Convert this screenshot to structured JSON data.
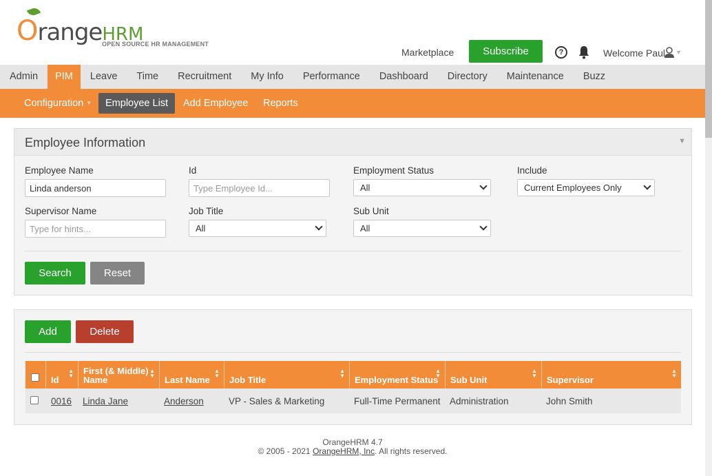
{
  "header": {
    "logo_o": "O",
    "logo_rest": "range",
    "logo_hrm": "HRM",
    "logo_tagline": "OPEN SOURCE HR MANAGEMENT",
    "marketplace_label": "Marketplace",
    "subscribe_label": "Subscribe",
    "help_glyph": "?",
    "welcome_text": "Welcome Paul",
    "user_caret": "▾"
  },
  "main_nav": {
    "items": [
      "Admin",
      "PIM",
      "Leave",
      "Time",
      "Recruitment",
      "My Info",
      "Performance",
      "Dashboard",
      "Directory",
      "Maintenance",
      "Buzz"
    ],
    "active": "PIM"
  },
  "sub_nav": {
    "configuration": "Configuration",
    "caret": "▼",
    "employee_list": "Employee List",
    "add_employee": "Add Employee",
    "reports": "Reports"
  },
  "search_panel": {
    "title": "Employee Information",
    "toggle_glyph": "▼",
    "employee_name_label": "Employee Name",
    "employee_name_value": "Linda anderson",
    "id_label": "Id",
    "id_placeholder": "Type Employee Id...",
    "employment_status_label": "Employment Status",
    "employment_status_value": "All",
    "include_label": "Include",
    "include_value": "Current Employees Only",
    "supervisor_label": "Supervisor Name",
    "supervisor_placeholder": "Type for hints...",
    "job_title_label": "Job Title",
    "job_title_value": "All",
    "sub_unit_label": "Sub Unit",
    "sub_unit_value": "All",
    "search_label": "Search",
    "reset_label": "Reset"
  },
  "results_panel": {
    "add_label": "Add",
    "delete_label": "Delete",
    "columns": {
      "id": "Id",
      "first_name": "First (& Middle) Name",
      "last_name": "Last Name",
      "job_title": "Job Title",
      "employment_status": "Employment Status",
      "sub_unit": "Sub Unit",
      "supervisor": "Supervisor"
    },
    "rows": [
      {
        "id": "0016",
        "first_name": "Linda Jane",
        "last_name": "Anderson",
        "job_title": "VP - Sales & Marketing",
        "employment_status": "Full-Time Permanent",
        "sub_unit": "Administration",
        "supervisor": "John Smith"
      }
    ]
  },
  "footer": {
    "version": "OrangeHRM 4.7",
    "copyright_pre": "© 2005 - 2021 ",
    "company_link": "OrangeHRM, Inc",
    "copyright_post": ". All rights reserved."
  },
  "colors": {
    "brand_orange": "#f28c38",
    "brand_green": "#28a22c",
    "delete_red": "#b83e2e"
  }
}
